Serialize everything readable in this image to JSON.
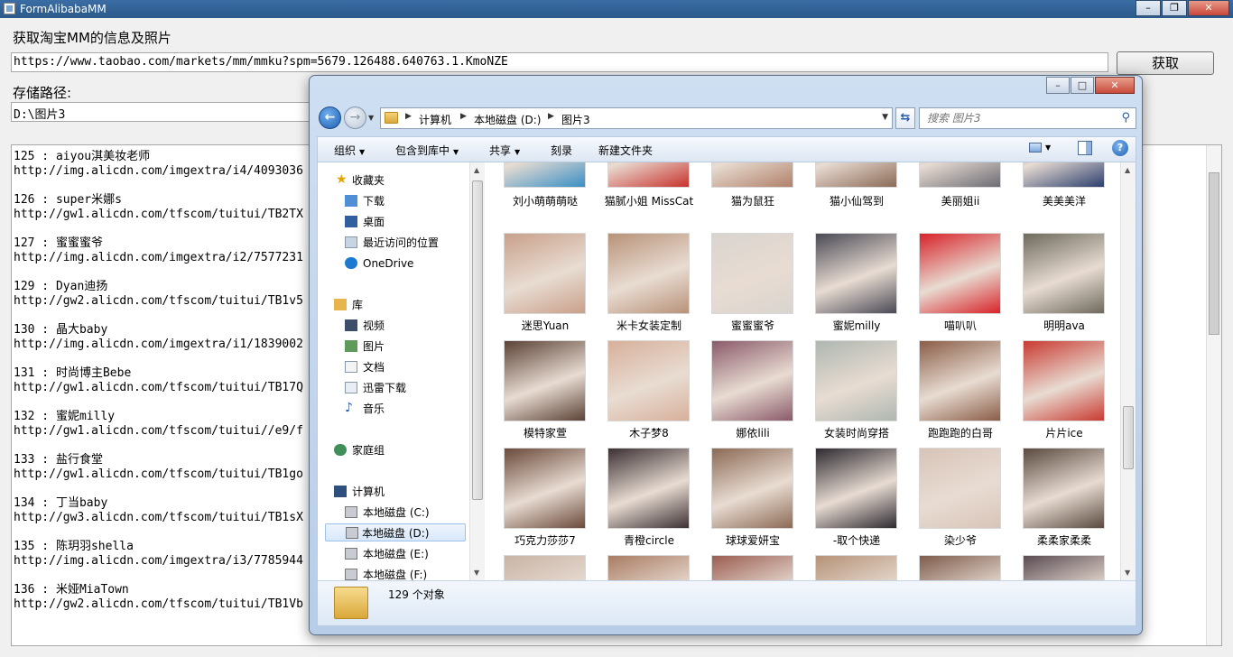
{
  "form": {
    "title": "FormAlibabaMM",
    "label_title": "获取淘宝MM的信息及照片",
    "url_value": "https://www.taobao.com/markets/mm/mmku?spm=5679.126488.640763.1.KmoNZE",
    "fetch_label": "获取",
    "label_path": "存储路径:",
    "path_value": "D:\\图片3",
    "log": [
      {
        "name": "125 : aiyou淇美妆老师",
        "url": "http://img.alicdn.com/imgextra/i4/4093036"
      },
      {
        "name": "126 : super米娜s",
        "url": "http://gw1.alicdn.com/tfscom/tuitui/TB2TX"
      },
      {
        "name": "127 : 蜜蜜蜜爷",
        "url": "http://img.alicdn.com/imgextra/i2/7577231"
      },
      {
        "name": "129 : Dyan迪扬",
        "url": "http://gw2.alicdn.com/tfscom/tuitui/TB1v5"
      },
      {
        "name": "130 : 晶大baby",
        "url": "http://img.alicdn.com/imgextra/i1/1839002"
      },
      {
        "name": "131 : 时尚博主Bebe",
        "url": "http://gw1.alicdn.com/tfscom/tuitui/TB17Q"
      },
      {
        "name": "132 : 蜜妮milly",
        "url": "http://gw1.alicdn.com/tfscom/tuitui//e9/f"
      },
      {
        "name": "133 : 盐行食堂",
        "url": "http://gw1.alicdn.com/tfscom/tuitui/TB1go"
      },
      {
        "name": "134 : 丁当baby",
        "url": "http://gw3.alicdn.com/tfscom/tuitui/TB1sX"
      },
      {
        "name": "135 : 陈玥羽shella",
        "url": "http://img.alicdn.com/imgextra/i3/7785944"
      },
      {
        "name": "136 : 米娅MiaTown",
        "url": "http://gw2.alicdn.com/tfscom/tuitui/TB1Vb"
      }
    ]
  },
  "explorer": {
    "crumbs": [
      "计算机",
      "本地磁盘 (D:)",
      "图片3"
    ],
    "search_placeholder": "搜索 图片3",
    "toolbar": {
      "organize": "组织",
      "include": "包含到库中",
      "share": "共享",
      "burn": "刻录",
      "new_folder": "新建文件夹"
    },
    "nav": {
      "favorites": "收藏夹",
      "downloads": "下载",
      "desktop": "桌面",
      "recent": "最近访问的位置",
      "onedrive": "OneDrive",
      "libraries": "库",
      "videos": "视频",
      "pictures": "图片",
      "documents": "文档",
      "xunlei": "迅雷下载",
      "music": "音乐",
      "homegroup": "家庭组",
      "computer": "计算机",
      "drive_c": "本地磁盘 (C:)",
      "drive_d": "本地磁盘 (D:)",
      "drive_e": "本地磁盘 (E:)",
      "drive_f": "本地磁盘 (F:)"
    },
    "files": [
      {
        "label": "刘小萌萌萌哒",
        "color": "#3a8fc4"
      },
      {
        "label": "猫腻小姐 MissCat",
        "color": "#c8332e"
      },
      {
        "label": "猫为鼠狂",
        "color": "#b0816a"
      },
      {
        "label": "猫小仙驾到",
        "color": "#8b6a57"
      },
      {
        "label": "美丽姐ii",
        "color": "#6c6c74"
      },
      {
        "label": "美美美洋",
        "color": "#2d3f6e"
      },
      {
        "label": "迷思Yuan",
        "color": "#c9a08a"
      },
      {
        "label": "米卡女装定制",
        "color": "#b89278"
      },
      {
        "label": "蜜蜜蜜爷",
        "color": "#d9d4cf"
      },
      {
        "label": "蜜妮milly",
        "color": "#4a4a55"
      },
      {
        "label": "喵叭叭",
        "color": "#d8232a"
      },
      {
        "label": "明明ava",
        "color": "#6e6a5d"
      },
      {
        "label": "模特家萱",
        "color": "#5b4236"
      },
      {
        "label": "木子梦8",
        "color": "#d7b09b"
      },
      {
        "label": "娜依lili",
        "color": "#8a5a6a"
      },
      {
        "label": "女装时尚穿搭",
        "color": "#aeb7b1"
      },
      {
        "label": "跑跑跑的白哥",
        "color": "#8a5d47"
      },
      {
        "label": "片片ice",
        "color": "#c93a32"
      },
      {
        "label": "巧克力莎莎7",
        "color": "#6b4a3b"
      },
      {
        "label": "青橙circle",
        "color": "#3c3034"
      },
      {
        "label": "球球爱妍宝",
        "color": "#8c6a55"
      },
      {
        "label": "-取个快递",
        "color": "#2e2a31"
      },
      {
        "label": "染少爷",
        "color": "#d8c4b8"
      },
      {
        "label": "柔柔家柔柔",
        "color": "#5a4a3f"
      },
      {
        "label": "",
        "color": "#c9b4a6"
      },
      {
        "label": "",
        "color": "#a97c63"
      },
      {
        "label": "",
        "color": "#9b5e52"
      },
      {
        "label": "",
        "color": "#b59277"
      },
      {
        "label": "",
        "color": "#7e5c4d"
      },
      {
        "label": "",
        "color": "#5a4c53"
      }
    ],
    "status": "129 个对象"
  }
}
